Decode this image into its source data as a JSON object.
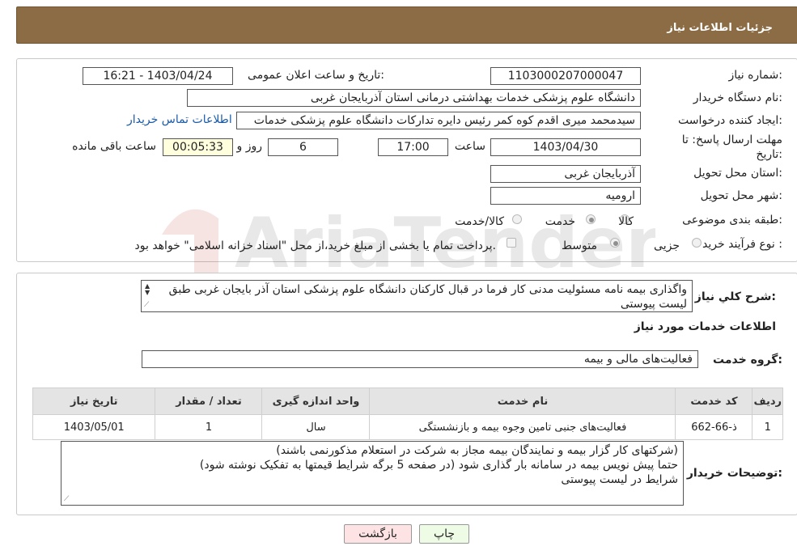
{
  "header": {
    "title": "جزئیات اطلاعات نیاز"
  },
  "info": {
    "need_number_label": "شماره نیاز:",
    "need_number": "1103000207000047",
    "announce_label": "تاریخ و ساعت اعلان عمومی:",
    "announce_value": "1403/04/24 - 16:21",
    "buyer_org_label": "نام دستگاه خریدار:",
    "buyer_org": "دانشگاه علوم پزشکی خدمات بهداشتی درمانی استان آذربایجان غربی",
    "creator_label": "ایجاد کننده درخواست:",
    "creator": "سیدمحمد میری اقدم کوه کمر رئیس دایره تدارکات دانشگاه علوم پزشکی خدمات",
    "contact_link": "اطلاعات تماس خریدار",
    "deadline_label_1": "مهلت ارسال پاسخ: تا",
    "deadline_label_2": "تاریخ:",
    "deadline_date": "1403/04/30",
    "time_label": "ساعت",
    "deadline_time": "17:00",
    "days_value": "6",
    "days_label": "روز و",
    "remaining_value": "00:05:33",
    "remaining_label": "ساعت باقی مانده",
    "province_label": "استان محل تحویل:",
    "province": "آذربایجان غربی",
    "city_label": "شهر محل تحویل:",
    "city": "ارومیه",
    "category_label": "طبقه بندی موضوعی:",
    "category_options": [
      "کالا",
      "خدمت",
      "کالا/خدمت"
    ],
    "category_selected": "خدمت",
    "process_label": "نوع فرآیند خرید :",
    "process_options": [
      "جزیی",
      "متوسط"
    ],
    "process_selected": "متوسط",
    "payment_note": "پرداخت تمام یا بخشی از مبلغ خرید،از محل \"اسناد خزانه اسلامی\" خواهد بود."
  },
  "description": {
    "label": "شرح کلي نياز:",
    "text": "واگذاری بیمه نامه مسئولیت مدنی کار فرما در قبال کارکنان دانشگاه علوم پزشکی استان آذر بایجان غربی طبق لیست پیوستی"
  },
  "services": {
    "title": "اطلاعات خدمات مورد نياز",
    "group_label": "گروه خدمت:",
    "group_value": "فعالیت‌های مالی و بیمه",
    "columns": [
      "ردیف",
      "کد خدمت",
      "نام خدمت",
      "واحد اندازه گیری",
      "تعداد / مقدار",
      "تاریخ نیاز"
    ],
    "rows": [
      [
        "1",
        "ذ-66-662",
        "فعالیت‌های جنبی تامین وجوه بیمه و بازنشستگی",
        "سال",
        "1",
        "1403/05/01"
      ]
    ]
  },
  "buyer_notes": {
    "label": "توضیحات خریدار:",
    "lines": [
      "(شرکتهای کار گزار بیمه و نمایندگان بیمه مجاز به شرکت در استعلام مذکورنمی باشند)",
      "حتما پیش نویس بیمه در سامانه بار گذاری شود (در صفحه 5 برگه شرایط قیمتها به تفکیک نوشته شود)",
      "شرایط در لیست پیوستی"
    ]
  },
  "buttons": {
    "print": "چاپ",
    "back": "بازگشت"
  },
  "watermark": "AriaTender.neT",
  "colors": {
    "header_bg": "#8b6c45",
    "link": "#1a5aa8",
    "print_bg": "#eefbe5",
    "back_bg": "#fde3e3",
    "remaining_bg": "#ffffdd"
  }
}
